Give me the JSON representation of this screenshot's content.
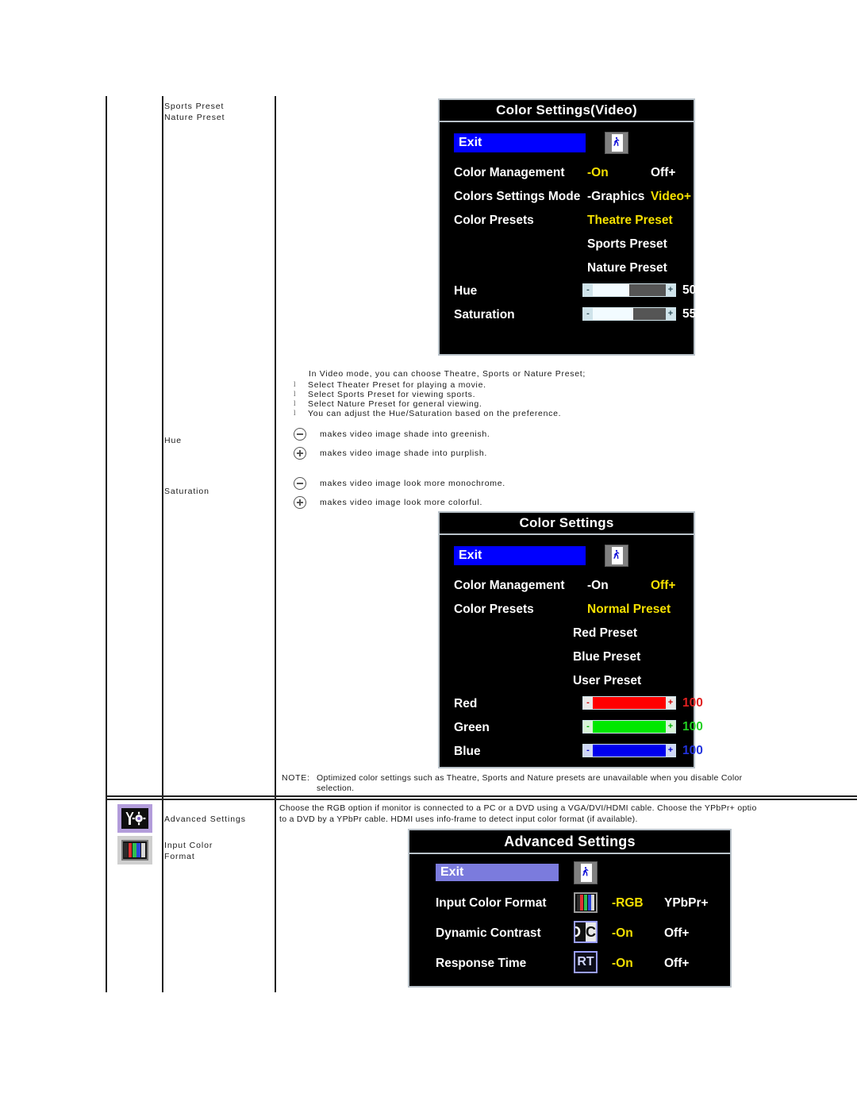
{
  "document": {
    "rows": [
      {
        "menu_labels": [
          "Sports Preset",
          "Nature Preset"
        ],
        "body_intro": "In Video mode, you can choose Theatre, Sports or Nature Preset;",
        "bullets": [
          "Select Theater Preset for playing a movie.",
          "Select Sports Preset for viewing sports.",
          "Select Nature Preset for general viewing.",
          "You can adjust the Hue/Saturation based on the preference."
        ]
      },
      {
        "menu_label": "Hue",
        "items": [
          {
            "icon": "minus-circle-icon",
            "text": "makes video image shade into greenish."
          },
          {
            "icon": "plus-circle-icon",
            "text": "makes video image shade into purplish."
          }
        ]
      },
      {
        "menu_label": "Saturation",
        "items": [
          {
            "icon": "minus-circle-icon",
            "text": "makes video image look more monochrome."
          },
          {
            "icon": "plus-circle-icon",
            "text": "makes video image look more colorful."
          }
        ]
      }
    ],
    "note": {
      "label": "NOTE:",
      "line1": "Optimized color settings such as Theatre, Sports and Nature presets are unavailable when you disable Color",
      "line2": "selection."
    },
    "advanced_row": {
      "menu_labels": [
        "Advanced Settings",
        "Input Color\nFormat"
      ],
      "menu_label_1": "Advanced Settings",
      "menu_label_2a": "Input Color",
      "menu_label_2b": "Format",
      "icon_1": "advanced-settings-icon",
      "icon_2": "input-color-format-icon",
      "body_line1": "Choose the RGB option if monitor is connected to a PC or a DVD using a VGA/DVI/HDMI cable. Choose the YPbPr+ optio",
      "body_line2": "to a DVD by a YPbPr cable. HDMI uses info-frame to detect input color format (if available)."
    }
  },
  "osd_video": {
    "title": "Color Settings(Video)",
    "exit_label": "Exit",
    "exit_icon": "exit-running-man-icon",
    "rows": [
      {
        "name": "Color Management",
        "opt1": "-On",
        "opt1_state": "selected",
        "opt2": "Off+",
        "opt2_state": "normal"
      },
      {
        "name": "Colors Settings Mode",
        "opt1": "-Graphics",
        "opt1_state": "normal",
        "opt2": "Video+",
        "opt2_state": "selected"
      },
      {
        "name": "Color Presets",
        "opt1": "Theatre Preset",
        "opt1_state": "selected"
      }
    ],
    "preset_list": [
      "Sports Preset",
      "Nature Preset"
    ],
    "sliders": [
      {
        "name": "Hue",
        "value": "50",
        "percent": 50,
        "minus": "-",
        "plus": "+"
      },
      {
        "name": "Saturation",
        "value": "55",
        "percent": 55,
        "minus": "-",
        "plus": "+"
      }
    ]
  },
  "osd_color": {
    "title": "Color Settings",
    "exit_label": "Exit",
    "exit_icon": "exit-running-man-icon",
    "rows": [
      {
        "name": "Color Management",
        "opt1": "-On",
        "opt1_state": "normal",
        "opt2": "Off+",
        "opt2_state": "selected"
      },
      {
        "name": "Color Presets",
        "opt1": "Normal Preset",
        "opt1_state": "selected"
      }
    ],
    "preset_list": [
      "Red Preset",
      "Blue Preset",
      "User Preset"
    ],
    "sliders": [
      {
        "name": "Red",
        "value": "100",
        "percent": 100,
        "minus": "-",
        "plus": "+"
      },
      {
        "name": "Green",
        "value": "100",
        "percent": 100,
        "minus": "-",
        "plus": "+"
      },
      {
        "name": "Blue",
        "value": "100",
        "percent": 100,
        "minus": "-",
        "plus": "+"
      }
    ]
  },
  "osd_advanced": {
    "title": "Advanced Settings",
    "exit_label": "Exit",
    "exit_icon": "exit-running-man-icon",
    "rows": [
      {
        "name": "Input Color Format",
        "icon": "color-bars-icon",
        "icon_text": "",
        "opt1": "-RGB",
        "opt1_state": "selected",
        "opt2": "YPbPr+",
        "opt2_state": "normal"
      },
      {
        "name": "Dynamic Contrast",
        "icon": "dc-icon",
        "icon_text": "DC",
        "opt1": "-On",
        "opt1_state": "selected",
        "opt2": "Off+",
        "opt2_state": "normal"
      },
      {
        "name": "Response Time",
        "icon": "rt-icon",
        "icon_text": "RT",
        "opt1": "-On",
        "opt1_state": "selected",
        "opt2": "Off+",
        "opt2_state": "normal"
      }
    ]
  },
  "colors": {
    "osd_background": "#000000",
    "osd_border": "#b9c2c9",
    "selected_yellow": "#f5e000",
    "exit_blue": "#0000ff",
    "exit_periwinkle": "#7b7bdd",
    "red": "#ff0000",
    "green": "#00e800",
    "blue": "#0000ee"
  }
}
